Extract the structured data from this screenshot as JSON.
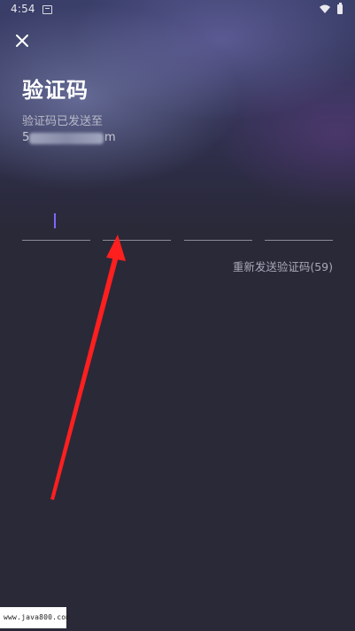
{
  "status_bar": {
    "time": "4:54",
    "icons": [
      "notification-icon",
      "wifi-icon",
      "battery-icon"
    ]
  },
  "header": {
    "close_icon": "close-icon",
    "title": "验证码",
    "subtitle": "验证码已发送至",
    "email_visible_start": "5",
    "email_visible_end": "m"
  },
  "code_input": {
    "box_count": 4,
    "values": [
      "",
      "",
      "",
      ""
    ],
    "active_index": 0,
    "cursor_color": "#7a68ff"
  },
  "resend": {
    "label": "重新发送验证码(59)"
  },
  "annotation": {
    "type": "arrow",
    "color": "#ff1f1f"
  },
  "watermark": {
    "text": "www.java800.com"
  }
}
